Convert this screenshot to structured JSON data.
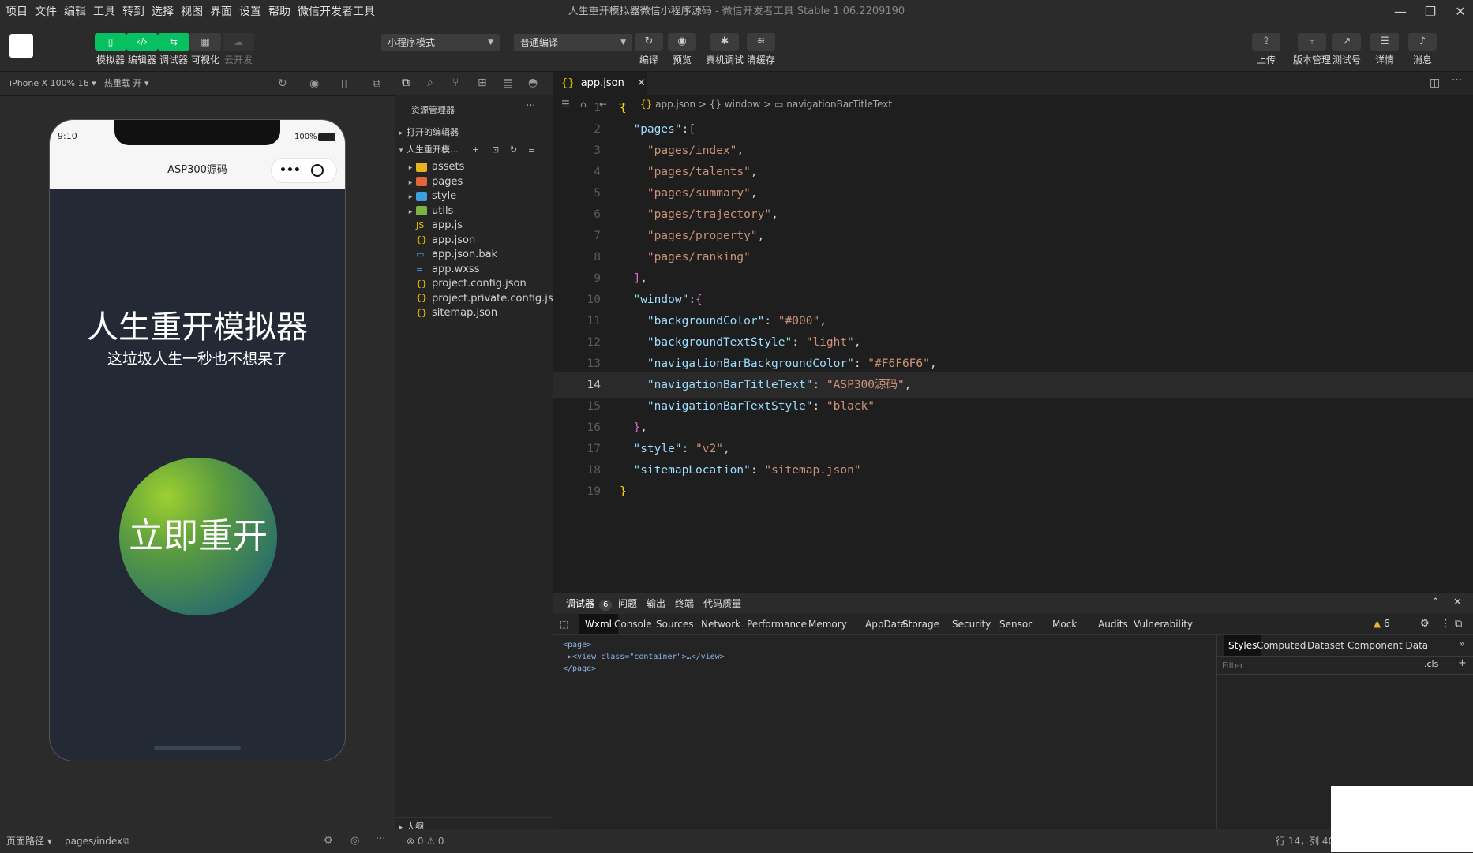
{
  "menu": [
    "项目",
    "文件",
    "编辑",
    "工具",
    "转到",
    "选择",
    "视图",
    "界面",
    "设置",
    "帮助",
    "微信开发者工具"
  ],
  "app_title": {
    "main": "人生重开模拟器微信小程序源码",
    "sub": "- 微信开发者工具 Stable 1.06.2209190"
  },
  "toolbar": {
    "left_buttons": [
      {
        "label": "模拟器",
        "icon": "phone-icon"
      },
      {
        "label": "编辑器",
        "icon": "code-icon"
      },
      {
        "label": "调试器",
        "icon": "debug-icon"
      },
      {
        "label": "可视化",
        "icon": "layout-icon"
      },
      {
        "label": "云开发",
        "icon": "cloud-icon"
      }
    ],
    "mode_select": "小程序模式",
    "compile_select": "普通编译",
    "mid_buttons": [
      {
        "label": "编译",
        "icon": "refresh-icon"
      },
      {
        "label": "预览",
        "icon": "eye-icon"
      },
      {
        "label": "真机调试",
        "icon": "bug-icon"
      },
      {
        "label": "清缓存",
        "icon": "layers-icon"
      }
    ],
    "right_buttons": [
      {
        "label": "上传",
        "icon": "upload-icon"
      },
      {
        "label": "版本管理",
        "icon": "branch-icon"
      },
      {
        "label": "测试号",
        "icon": "external-icon"
      },
      {
        "label": "详情",
        "icon": "menu-icon"
      },
      {
        "label": "消息",
        "icon": "bell-icon"
      }
    ]
  },
  "simulator": {
    "device_select": "iPhone X 100% 16",
    "hot_reload": "热重载 开",
    "status_time": "9:10",
    "battery": "100%",
    "nav_title": "ASP300源码",
    "capsule_more": "•••",
    "title": "人生重开模拟器",
    "subtitle": "这垃圾人生一秒也不想呆了",
    "start_button": "立即重开",
    "page_path_label": "页面路径",
    "page_path": "pages/index"
  },
  "explorer": {
    "title": "资源管理器",
    "more": "···",
    "open_editors": "打开的编辑器",
    "project": "人生重开模...",
    "items": [
      {
        "name": "assets",
        "type": "folder",
        "color": "#e6b422"
      },
      {
        "name": "pages",
        "type": "folder",
        "color": "#e0663a"
      },
      {
        "name": "style",
        "type": "folder",
        "color": "#3f9ede"
      },
      {
        "name": "utils",
        "type": "folder",
        "color": "#7cb342"
      },
      {
        "name": "app.js",
        "type": "js",
        "color": "#e5c100"
      },
      {
        "name": "app.json",
        "type": "json",
        "color": "#e5c100"
      },
      {
        "name": "app.json.bak",
        "type": "file",
        "color": "#5b9bd5"
      },
      {
        "name": "app.wxss",
        "type": "wxss",
        "color": "#3f9ede"
      },
      {
        "name": "project.config.json",
        "type": "json",
        "color": "#e5c100"
      },
      {
        "name": "project.private.config.js...",
        "type": "json",
        "color": "#e5c100"
      },
      {
        "name": "sitemap.json",
        "type": "json",
        "color": "#e5c100"
      }
    ],
    "outline": "大纲"
  },
  "editor": {
    "tab": "app.json",
    "breadcrumb": [
      "app.json",
      "window",
      "navigationBarTitleText"
    ],
    "active_line": 14,
    "lines": [
      {
        "n": "1",
        "t": [
          [
            "b",
            "{"
          ]
        ]
      },
      {
        "n": "2",
        "t": [
          [
            "p",
            "  "
          ],
          [
            "k",
            "\"pages\""
          ],
          [
            "p",
            ":"
          ],
          [
            "b2",
            "["
          ]
        ]
      },
      {
        "n": "3",
        "t": [
          [
            "p",
            "    "
          ],
          [
            "s",
            "\"pages/index\""
          ],
          [
            "p",
            ","
          ]
        ]
      },
      {
        "n": "4",
        "t": [
          [
            "p",
            "    "
          ],
          [
            "s",
            "\"pages/talents\""
          ],
          [
            "p",
            ","
          ]
        ]
      },
      {
        "n": "5",
        "t": [
          [
            "p",
            "    "
          ],
          [
            "s",
            "\"pages/summary\""
          ],
          [
            "p",
            ","
          ]
        ]
      },
      {
        "n": "6",
        "t": [
          [
            "p",
            "    "
          ],
          [
            "s",
            "\"pages/trajectory\""
          ],
          [
            "p",
            ","
          ]
        ]
      },
      {
        "n": "7",
        "t": [
          [
            "p",
            "    "
          ],
          [
            "s",
            "\"pages/property\""
          ],
          [
            "p",
            ","
          ]
        ]
      },
      {
        "n": "8",
        "t": [
          [
            "p",
            "    "
          ],
          [
            "s",
            "\"pages/ranking\""
          ]
        ]
      },
      {
        "n": "9",
        "t": [
          [
            "p",
            "  "
          ],
          [
            "b2",
            "]"
          ],
          [
            "p",
            ","
          ]
        ]
      },
      {
        "n": "10",
        "t": [
          [
            "p",
            "  "
          ],
          [
            "k",
            "\"window\""
          ],
          [
            "p",
            ":"
          ],
          [
            "b2",
            "{"
          ]
        ]
      },
      {
        "n": "11",
        "t": [
          [
            "p",
            "    "
          ],
          [
            "k",
            "\"backgroundColor\""
          ],
          [
            "p",
            ": "
          ],
          [
            "s",
            "\"#000\""
          ],
          [
            "p",
            ","
          ]
        ]
      },
      {
        "n": "12",
        "t": [
          [
            "p",
            "    "
          ],
          [
            "k",
            "\"backgroundTextStyle\""
          ],
          [
            "p",
            ": "
          ],
          [
            "s",
            "\"light\""
          ],
          [
            "p",
            ","
          ]
        ]
      },
      {
        "n": "13",
        "t": [
          [
            "p",
            "    "
          ],
          [
            "k",
            "\"navigationBarBackgroundColor\""
          ],
          [
            "p",
            ": "
          ],
          [
            "s",
            "\"#F6F6F6\""
          ],
          [
            "p",
            ","
          ]
        ]
      },
      {
        "n": "14",
        "t": [
          [
            "p",
            "    "
          ],
          [
            "k",
            "\"navigationBarTitleText\""
          ],
          [
            "p",
            ": "
          ],
          [
            "s",
            "\"ASP300源码\""
          ],
          [
            "p",
            ","
          ]
        ]
      },
      {
        "n": "15",
        "t": [
          [
            "p",
            "    "
          ],
          [
            "k",
            "\"navigationBarTextStyle\""
          ],
          [
            "p",
            ": "
          ],
          [
            "s",
            "\"black\""
          ]
        ]
      },
      {
        "n": "16",
        "t": [
          [
            "p",
            "  "
          ],
          [
            "b2",
            "}"
          ],
          [
            "p",
            ","
          ]
        ]
      },
      {
        "n": "17",
        "t": [
          [
            "p",
            "  "
          ],
          [
            "k",
            "\"style\""
          ],
          [
            "p",
            ": "
          ],
          [
            "s",
            "\"v2\""
          ],
          [
            "p",
            ","
          ]
        ]
      },
      {
        "n": "18",
        "t": [
          [
            "p",
            "  "
          ],
          [
            "k",
            "\"sitemapLocation\""
          ],
          [
            "p",
            ": "
          ],
          [
            "s",
            "\"sitemap.json\""
          ]
        ]
      },
      {
        "n": "19",
        "t": [
          [
            "b",
            "}"
          ]
        ]
      }
    ]
  },
  "devtools": {
    "top_tabs": [
      {
        "label": "调试器",
        "badge": "6"
      },
      {
        "label": "问题"
      },
      {
        "label": "输出"
      },
      {
        "label": "终端"
      },
      {
        "label": "代码质量"
      }
    ],
    "tabs": [
      "Wxml",
      "Console",
      "Sources",
      "Network",
      "Performance",
      "Memory",
      "AppData",
      "Storage",
      "Security",
      "Sensor",
      "Mock",
      "Audits",
      "Vulnerability"
    ],
    "warnings": "6",
    "wxml": [
      "<page>",
      "<view class=\"container\">…</view>",
      "</page>"
    ],
    "style_tabs": [
      "Styles",
      "Computed",
      "Dataset",
      "Component Data"
    ],
    "filter_placeholder": "Filter",
    "cls": ".cls"
  },
  "status": {
    "errors": "0",
    "warnings": "0",
    "cursor": "行 14，列 40"
  }
}
